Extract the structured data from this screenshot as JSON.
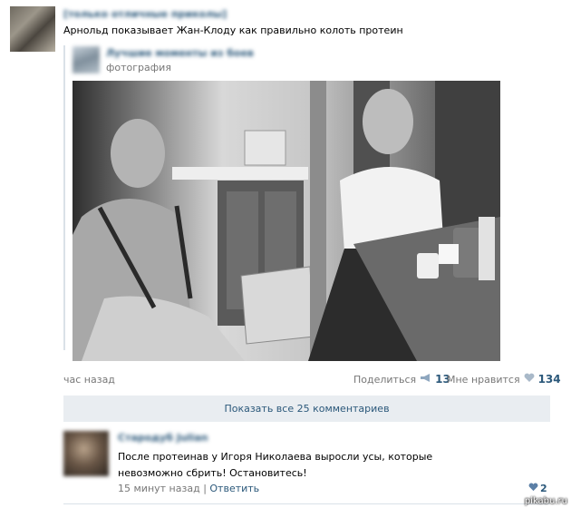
{
  "post": {
    "group_name": "[только отличные приколы]",
    "text": "Арнольд показывает Жан-Клоду как правильно колоть протеин",
    "time": "час назад"
  },
  "repost": {
    "group_name": "Лучшие моменты из боев",
    "subtitle": "фотография"
  },
  "actions": {
    "share_label": "Поделиться",
    "share_count": "13",
    "like_label": "Мне нравится",
    "like_count": "134"
  },
  "comments": {
    "show_all": "Показать все 25 комментариев",
    "items": [
      {
        "author": "Стародуб Julian",
        "text": "После протеинав у Игоря Николаева выросли усы, которые невозможно сбрить! Остановитесь!",
        "time": "15 минут назад",
        "reply": "Ответить",
        "likes": "2"
      }
    ]
  },
  "icons": {
    "share": "megaphone-icon",
    "like": "heart-icon"
  },
  "colors": {
    "link": "#2b587a",
    "muted": "#777777",
    "comments_bar": "#e9edf1"
  },
  "watermark": "pikabu.ru"
}
